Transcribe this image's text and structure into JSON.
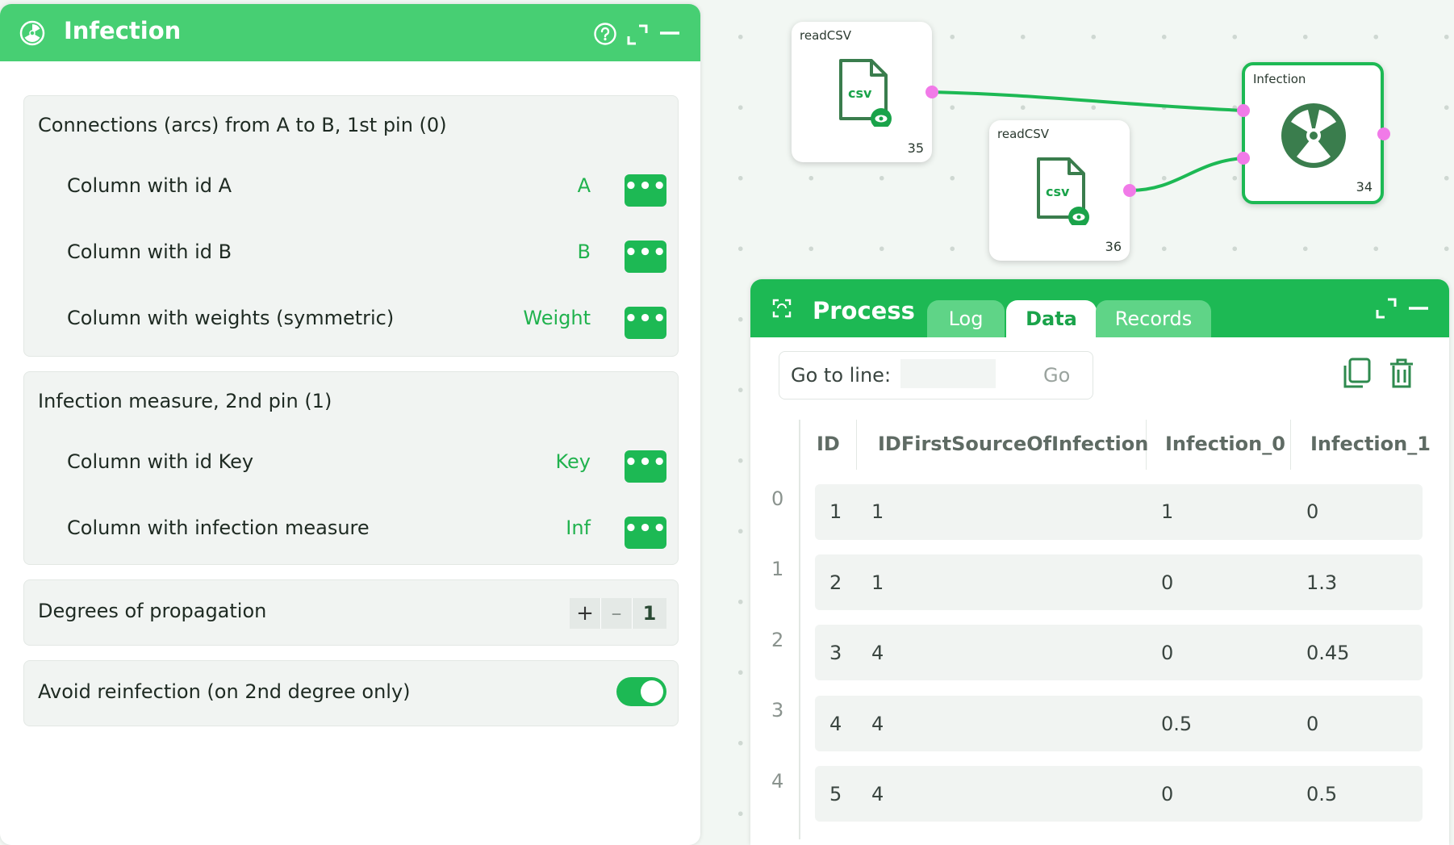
{
  "left_panel": {
    "title": "Infection",
    "section_connections": {
      "title": "Connections (arcs) from A to B, 1st pin (0)",
      "rows": [
        {
          "label": "Column with id A",
          "value": "A"
        },
        {
          "label": "Column with id B",
          "value": "B"
        },
        {
          "label": "Column with weights (symmetric)",
          "value": "Weight"
        }
      ]
    },
    "section_infection": {
      "title": "Infection measure, 2nd pin (1)",
      "rows": [
        {
          "label": "Column with id Key",
          "value": "Key"
        },
        {
          "label": "Column with infection measure",
          "value": "Inf"
        }
      ]
    },
    "degrees": {
      "label": "Degrees of propagation",
      "plus": "+",
      "minus": "–",
      "value": "1"
    },
    "avoid": {
      "label": "Avoid reinfection (on 2nd degree only)",
      "checked": true
    },
    "more_glyph": "•••"
  },
  "graph": {
    "nodes": [
      {
        "label": "readCSV",
        "number": "35",
        "icon_text": "csv"
      },
      {
        "label": "readCSV",
        "number": "36",
        "icon_text": "csv"
      },
      {
        "label": "Infection",
        "number": "34"
      }
    ]
  },
  "process": {
    "title": "Process",
    "tabs": [
      "Log",
      "Data",
      "Records"
    ],
    "active_tab": "Data",
    "goto_label": "Go to line:",
    "goto_value": "",
    "go_button": "Go",
    "columns": [
      "ID",
      "IDFirstSourceOfInfection",
      "Infection_0",
      "Infection_1"
    ],
    "rows": [
      {
        "index": "0",
        "cells": [
          "1",
          "1",
          "1",
          "0"
        ]
      },
      {
        "index": "1",
        "cells": [
          "2",
          "1",
          "0",
          "1.3"
        ]
      },
      {
        "index": "2",
        "cells": [
          "3",
          "4",
          "0",
          "0.45"
        ]
      },
      {
        "index": "3",
        "cells": [
          "4",
          "4",
          "0.5",
          "0"
        ]
      },
      {
        "index": "4",
        "cells": [
          "5",
          "4",
          "0",
          "0.5"
        ]
      }
    ]
  },
  "colors": {
    "accent": "#47cf73",
    "accent_dark": "#1db954",
    "pin": "#f17ae8",
    "icon_green": "#3a7d4d"
  }
}
